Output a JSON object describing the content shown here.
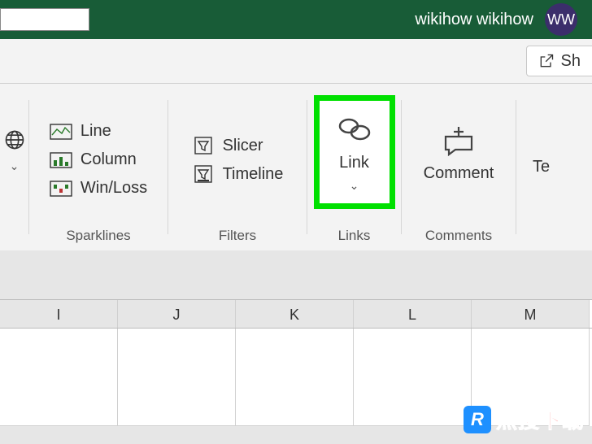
{
  "titlebar": {
    "username": "wikihow wikihow",
    "avatar_initials": "WW"
  },
  "share": {
    "label": "Sh"
  },
  "ribbon": {
    "sparklines": {
      "label": "Sparklines",
      "items": {
        "line": "Line",
        "column": "Column",
        "winloss": "Win/Loss"
      }
    },
    "filters": {
      "label": "Filters",
      "items": {
        "slicer": "Slicer",
        "timeline": "Timeline"
      }
    },
    "links": {
      "label": "Links",
      "button": "Link"
    },
    "comments": {
      "label": "Comments",
      "button": "Comment"
    },
    "text_stub": "Te"
  },
  "columns": [
    "I",
    "J",
    "K",
    "L",
    "M"
  ],
  "watermark": {
    "r": "R",
    "text": "热搜下载"
  }
}
